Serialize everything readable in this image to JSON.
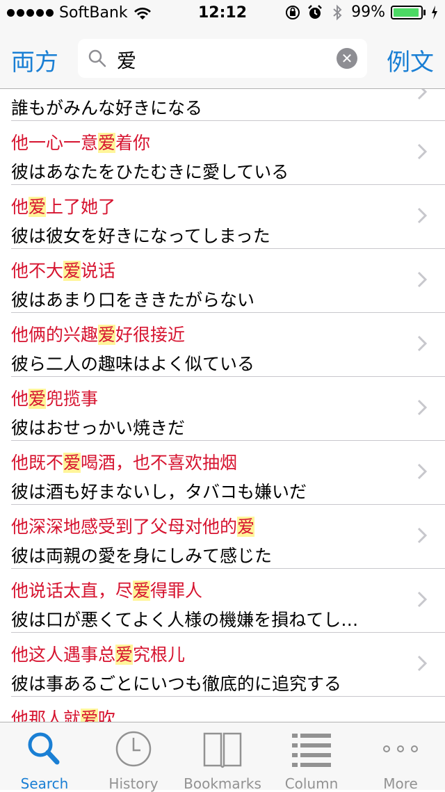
{
  "status_bar": {
    "carrier": "SoftBank",
    "time": "12:12",
    "battery": "99%"
  },
  "nav": {
    "left_button": "両方",
    "right_button": "例文",
    "search_query": "爱"
  },
  "colors": {
    "accent": "#1a7fd4",
    "chinese_text": "#d6132f",
    "highlight": "#fff59a"
  },
  "results": [
    {
      "cn_before": "",
      "cn_hl": "",
      "cn_after": "",
      "jp": "誰もがみんな好きになる"
    },
    {
      "cn_before": "他一心一意",
      "cn_hl": "爱",
      "cn_after": "着你",
      "jp": "彼はあなたをひたむきに愛している"
    },
    {
      "cn_before": "他",
      "cn_hl": "爱",
      "cn_after": "上了她了",
      "jp": "彼は彼女を好きになってしまった"
    },
    {
      "cn_before": "他不大",
      "cn_hl": "爱",
      "cn_after": "说话",
      "jp": "彼はあまり口をききたがらない"
    },
    {
      "cn_before": "他俩的兴趣",
      "cn_hl": "爱",
      "cn_after": "好很接近",
      "jp": "彼ら二人の趣味はよく似ている"
    },
    {
      "cn_before": "他",
      "cn_hl": "爱",
      "cn_after": "兜揽事",
      "jp": "彼はおせっかい焼きだ"
    },
    {
      "cn_before": "他既不",
      "cn_hl": "爱",
      "cn_after": "喝酒，也不喜欢抽烟",
      "jp": "彼は酒も好まないし，タバコも嫌いだ"
    },
    {
      "cn_before": "他深深地感受到了父母对他的",
      "cn_hl": "爱",
      "cn_after": "",
      "jp": "彼は両親の愛を身にしみて感じた"
    },
    {
      "cn_before": "他说话太直，尽",
      "cn_hl": "爱",
      "cn_after": "得罪人",
      "jp": "彼は口が悪くてよく人様の機嫌を損ねてし…"
    },
    {
      "cn_before": "他这人遇事总",
      "cn_hl": "爱",
      "cn_after": "究根儿",
      "jp": "彼は事あるごとにいつも徹底的に追究する"
    },
    {
      "cn_before": "他那人就",
      "cn_hl": "爱",
      "cn_after": "吹",
      "jp": ""
    }
  ],
  "tabs": [
    {
      "label": "Search",
      "icon": "search-icon",
      "active": true
    },
    {
      "label": "History",
      "icon": "clock-icon",
      "active": false
    },
    {
      "label": "Bookmarks",
      "icon": "book-icon",
      "active": false
    },
    {
      "label": "Column",
      "icon": "list-icon",
      "active": false
    },
    {
      "label": "More",
      "icon": "more-dots-icon",
      "active": false
    }
  ]
}
